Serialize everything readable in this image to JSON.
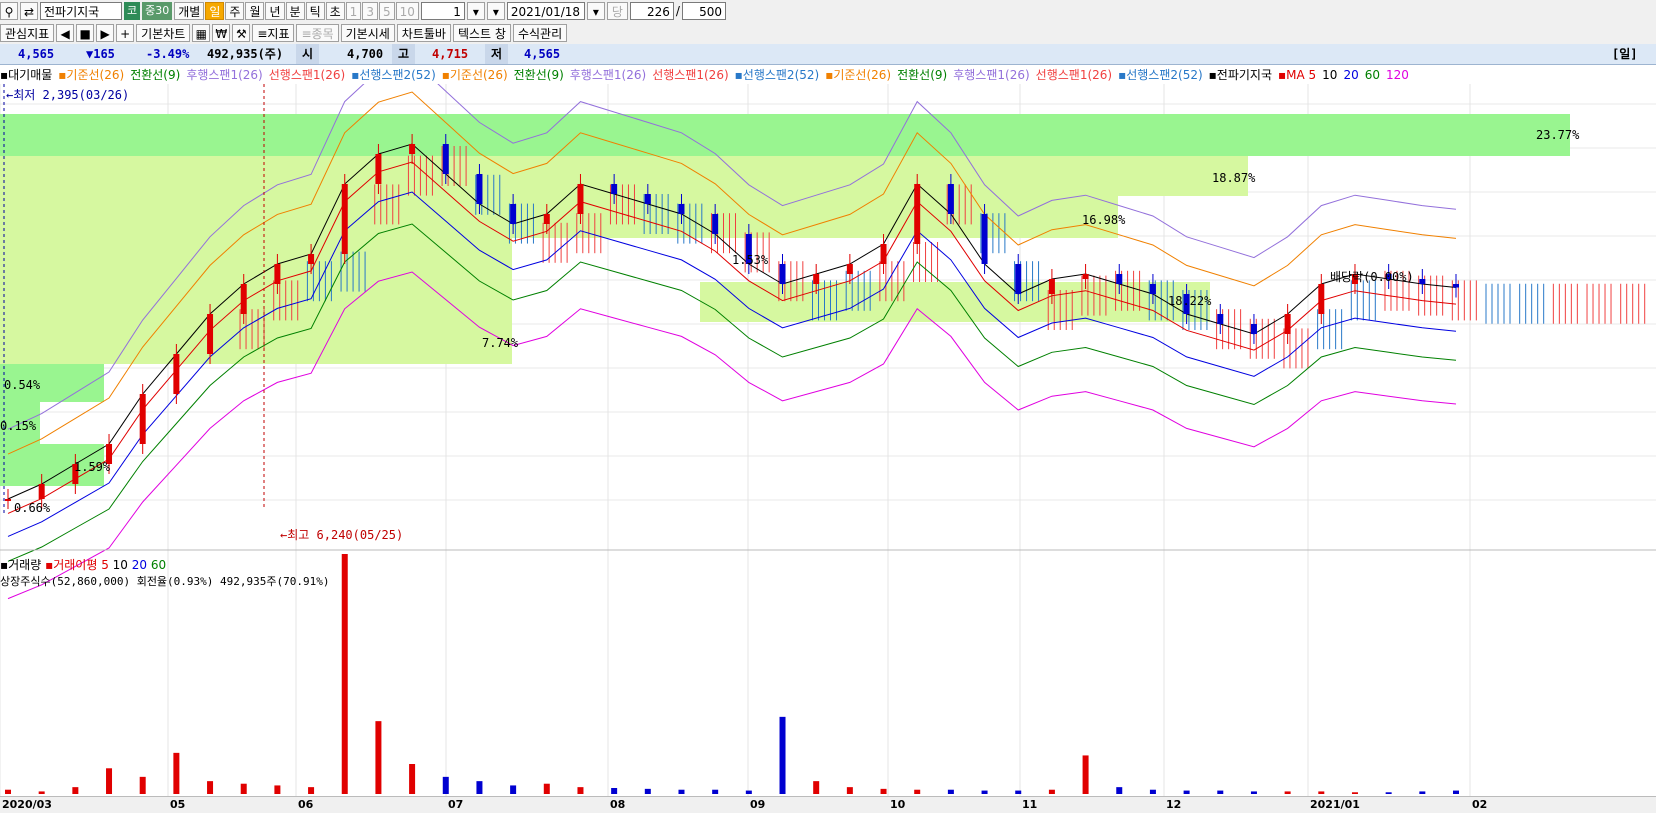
{
  "toolbar": {
    "stock_name": "전파기지국",
    "market_badge": "코",
    "index_badge": "중30",
    "period_buttons": [
      "개별",
      "일",
      "주",
      "월",
      "년",
      "분",
      "틱",
      "초"
    ],
    "selected_period": "일",
    "interval_numbers": [
      "1",
      "3",
      "5",
      "10"
    ],
    "interval_value": "1",
    "date": "2021/01/18",
    "date_suffix": "당",
    "count": "226",
    "separator": "/",
    "total": "500"
  },
  "toolbar2": {
    "buttons": [
      "관심지표",
      "기본차트",
      "≡지표",
      "≡종목",
      "기본시세",
      "차트툴바",
      "텍스트 창",
      "수식관리"
    ]
  },
  "price_bar": {
    "current": "4,565",
    "change": "▼165",
    "change_pct": "-3.49%",
    "volume": "492,935(주)",
    "open_label": "시",
    "open": "4,700",
    "high_label": "고",
    "high": "4,715",
    "low_label": "저",
    "low": "4,565",
    "period_tag": "[일]"
  },
  "legend": {
    "items": [
      {
        "text": "▪대기매물",
        "color": "#000000"
      },
      {
        "text": "▪기준선(26)",
        "color": "#f08000"
      },
      {
        "text": "전환선(9)",
        "color": "#008000"
      },
      {
        "text": "후행스팬1(26)",
        "color": "#9370db"
      },
      {
        "text": "선행스팬1(26)",
        "color": "#f04040"
      },
      {
        "text": "▪선행스팬2(52)",
        "color": "#2878c8"
      },
      {
        "text": "▪기준선(26)",
        "color": "#f08000"
      },
      {
        "text": "전환선(9)",
        "color": "#008000"
      },
      {
        "text": "후행스팬1(26)",
        "color": "#9370db"
      },
      {
        "text": "선행스팬1(26)",
        "color": "#f04040"
      },
      {
        "text": "▪선행스팬2(52)",
        "color": "#2878c8"
      },
      {
        "text": "▪기준선(26)",
        "color": "#f08000"
      },
      {
        "text": "전환선(9)",
        "color": "#008000"
      },
      {
        "text": "후행스팬1(26)",
        "color": "#9370db"
      },
      {
        "text": "선행스팬1(26)",
        "color": "#f04040"
      },
      {
        "text": "▪선행스팬2(52)",
        "color": "#2878c8"
      },
      {
        "text": "▪전파기지국",
        "color": "#000000"
      },
      {
        "text": "▪MA 5",
        "color": "#e00000"
      },
      {
        "text": "10",
        "color": "#000000"
      },
      {
        "text": "20",
        "color": "#0000e0"
      },
      {
        "text": "60",
        "color": "#008000"
      },
      {
        "text": "120",
        "color": "#e000e0"
      }
    ]
  },
  "annotations": {
    "low_marker": "←최저 2,395(03/26)",
    "high_marker": "←최고 6,240(05/25)",
    "dividend": "배당락(0.00%)",
    "zone_pcts": [
      "23.77%",
      "18.87%",
      "16.98%",
      "7.74%",
      "0.54%",
      "0.15%",
      "1.59%",
      "0.66%",
      "1.53%",
      "18.22%"
    ]
  },
  "volume_legend": {
    "title": "▪거래량",
    "ma_label": "▪거래이평 5",
    "ma_values": [
      "10",
      "20",
      "60"
    ],
    "shares_info": "상장주식수(52,860,000) 회전율(0.93%) 492,935주(70.91%)"
  },
  "x_axis": {
    "labels": [
      "2020/03",
      "05",
      "06",
      "07",
      "08",
      "09",
      "10",
      "11",
      "12",
      "2021/01",
      "02"
    ]
  },
  "colors": {
    "up": "#e00000",
    "down": "#0000d0",
    "zone": "#99f590",
    "zone_light": "#d6f8a0",
    "cloud_up": "#f04040",
    "cloud_down": "#2878c8"
  },
  "chart_data": {
    "type": "candlestick",
    "x": [
      "2020/03",
      "05",
      "06",
      "07",
      "08",
      "09",
      "10",
      "11",
      "12",
      "2021/01",
      "02"
    ],
    "price_low": 2395,
    "price_high": 6240,
    "close_path": [
      2450,
      2600,
      2800,
      3000,
      3500,
      3900,
      4300,
      4600,
      4800,
      4900,
      5600,
      5900,
      6000,
      5700,
      5400,
      5200,
      5300,
      5600,
      5500,
      5400,
      5300,
      5100,
      4800,
      4600,
      4700,
      4800,
      5000,
      5600,
      5300,
      4800,
      4500,
      4650,
      4700,
      4600,
      4500,
      4300,
      4200,
      4100,
      4300,
      4600,
      4700,
      4650,
      4600,
      4565
    ],
    "volume": [
      5,
      3,
      8,
      30,
      20,
      48,
      15,
      12,
      10,
      8,
      280,
      85,
      35,
      20,
      15,
      10,
      12,
      8,
      7,
      6,
      5,
      5,
      4,
      90,
      15,
      8,
      6,
      5,
      5,
      4,
      4,
      5,
      45,
      8,
      5,
      4,
      4,
      3,
      3,
      3,
      2,
      2,
      3,
      4
    ]
  }
}
